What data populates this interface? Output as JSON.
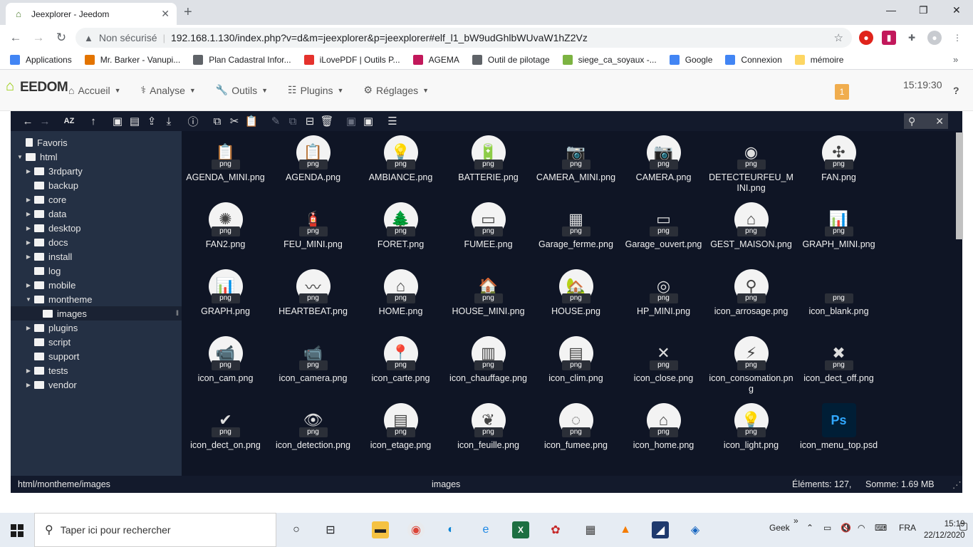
{
  "browser": {
    "tab_title": "Jeexplorer - Jeedom",
    "security_label": "Non sécurisé",
    "url": "192.168.1.130/index.php?v=d&m=jeexplorer&p=jeexplorer#elf_l1_bW9udGhlbWUvaW1hZ2Vz",
    "bookmarks": [
      {
        "label": "Applications",
        "color": "#4285f4"
      },
      {
        "label": "Mr. Barker - Vanupi...",
        "color": "#e37400"
      },
      {
        "label": "Plan Cadastral Infor...",
        "color": "#5f6368"
      },
      {
        "label": "iLovePDF | Outils P...",
        "color": "#e5322d"
      },
      {
        "label": "AGEMA",
        "color": "#c2185b"
      },
      {
        "label": "Outil de pilotage",
        "color": "#5f6368"
      },
      {
        "label": "siege_ca_soyaux -...",
        "color": "#7cb342"
      },
      {
        "label": "Google",
        "color": "#4285f4"
      },
      {
        "label": "Connexion",
        "color": "#4285f4"
      },
      {
        "label": "mémoire",
        "color": "#fdd663"
      }
    ]
  },
  "jeedom": {
    "logo_text": "EEDOM",
    "menu": [
      {
        "label": "Accueil",
        "icon": "home-icon"
      },
      {
        "label": "Analyse",
        "icon": "stethoscope-icon"
      },
      {
        "label": "Outils",
        "icon": "wrench-icon"
      },
      {
        "label": "Plugins",
        "icon": "list-icon"
      },
      {
        "label": "Réglages",
        "icon": "gear-icon"
      }
    ],
    "message_count": "1",
    "time": "15:19:30",
    "help_label": "?"
  },
  "explorer": {
    "tree": [
      {
        "label": "Favoris",
        "depth": 0,
        "arrow": "",
        "type": "star"
      },
      {
        "label": "html",
        "depth": 0,
        "arrow": "▼",
        "type": "folder"
      },
      {
        "label": "3rdparty",
        "depth": 1,
        "arrow": "▶",
        "type": "folder"
      },
      {
        "label": "backup",
        "depth": 1,
        "arrow": "",
        "type": "folder"
      },
      {
        "label": "core",
        "depth": 1,
        "arrow": "▶",
        "type": "folder"
      },
      {
        "label": "data",
        "depth": 1,
        "arrow": "▶",
        "type": "folder"
      },
      {
        "label": "desktop",
        "depth": 1,
        "arrow": "▶",
        "type": "folder"
      },
      {
        "label": "docs",
        "depth": 1,
        "arrow": "▶",
        "type": "folder"
      },
      {
        "label": "install",
        "depth": 1,
        "arrow": "▶",
        "type": "folder"
      },
      {
        "label": "log",
        "depth": 1,
        "arrow": "",
        "type": "folder"
      },
      {
        "label": "mobile",
        "depth": 1,
        "arrow": "▶",
        "type": "folder"
      },
      {
        "label": "montheme",
        "depth": 1,
        "arrow": "▼",
        "type": "folder"
      },
      {
        "label": "images",
        "depth": 2,
        "arrow": "",
        "type": "open-folder",
        "selected": true
      },
      {
        "label": "plugins",
        "depth": 1,
        "arrow": "▶",
        "type": "folder"
      },
      {
        "label": "script",
        "depth": 1,
        "arrow": "",
        "type": "folder"
      },
      {
        "label": "support",
        "depth": 1,
        "arrow": "",
        "type": "folder"
      },
      {
        "label": "tests",
        "depth": 1,
        "arrow": "▶",
        "type": "folder"
      },
      {
        "label": "vendor",
        "depth": 1,
        "arrow": "▶",
        "type": "folder"
      }
    ],
    "file_tag": "png",
    "files": [
      {
        "name": "AGENDA_MINI.png",
        "glyph": "📋",
        "circle": false
      },
      {
        "name": "AGENDA.png",
        "glyph": "📋",
        "circle": true
      },
      {
        "name": "AMBIANCE.png",
        "glyph": "💡",
        "circle": true
      },
      {
        "name": "BATTERIE.png",
        "glyph": "🔋",
        "circle": true
      },
      {
        "name": "CAMERA_MINI.png",
        "glyph": "📷",
        "circle": false
      },
      {
        "name": "CAMERA.png",
        "glyph": "📷",
        "circle": true
      },
      {
        "name": "DETECTEURFEU_MINI.png",
        "glyph": "◉",
        "circle": false
      },
      {
        "name": "FAN.png",
        "glyph": "✣",
        "circle": true
      },
      {
        "name": "FAN2.png",
        "glyph": "✺",
        "circle": true
      },
      {
        "name": "FEU_MINI.png",
        "glyph": "🧯",
        "circle": false
      },
      {
        "name": "FORET.png",
        "glyph": "🌲",
        "circle": true
      },
      {
        "name": "FUMEE.png",
        "glyph": "▭",
        "circle": true
      },
      {
        "name": "Garage_ferme.png",
        "glyph": "▦",
        "circle": false
      },
      {
        "name": "Garage_ouvert.png",
        "glyph": "▭",
        "circle": false
      },
      {
        "name": "GEST_MAISON.png",
        "glyph": "⌂",
        "circle": true
      },
      {
        "name": "GRAPH_MINI.png",
        "glyph": "📊",
        "circle": false
      },
      {
        "name": "GRAPH.png",
        "glyph": "📊",
        "circle": true
      },
      {
        "name": "HEARTBEAT.png",
        "glyph": "〰",
        "circle": true
      },
      {
        "name": "HOME.png",
        "glyph": "⌂",
        "circle": true
      },
      {
        "name": "HOUSE_MINI.png",
        "glyph": "🏠",
        "circle": false
      },
      {
        "name": "HOUSE.png",
        "glyph": "🏡",
        "circle": true
      },
      {
        "name": "HP_MINI.png",
        "glyph": "◎",
        "circle": false
      },
      {
        "name": "icon_arrosage.png",
        "glyph": "⚲",
        "circle": true
      },
      {
        "name": "icon_blank.png",
        "glyph": "",
        "circle": false
      },
      {
        "name": "icon_cam.png",
        "glyph": "📹",
        "circle": true
      },
      {
        "name": "icon_camera.png",
        "glyph": "📹",
        "circle": false
      },
      {
        "name": "icon_carte.png",
        "glyph": "📍",
        "circle": true
      },
      {
        "name": "icon_chauffage.png",
        "glyph": "▥",
        "circle": true
      },
      {
        "name": "icon_clim.png",
        "glyph": "▤",
        "circle": true
      },
      {
        "name": "icon_close.png",
        "glyph": "✕",
        "circle": false
      },
      {
        "name": "icon_consomation.png",
        "glyph": "⚡",
        "circle": true
      },
      {
        "name": "icon_dect_off.png",
        "glyph": "✖",
        "circle": false
      },
      {
        "name": "icon_dect_on.png",
        "glyph": "✔",
        "circle": false
      },
      {
        "name": "icon_detection.png",
        "glyph": "👁",
        "circle": false
      },
      {
        "name": "icon_etage.png",
        "glyph": "▤",
        "circle": true
      },
      {
        "name": "icon_feuille.png",
        "glyph": "❦",
        "circle": true
      },
      {
        "name": "icon_fumee.png",
        "glyph": "◌",
        "circle": true
      },
      {
        "name": "icon_home.png",
        "glyph": "⌂",
        "circle": true
      },
      {
        "name": "icon_light.png",
        "glyph": "💡",
        "circle": true
      },
      {
        "name": "icon_menu_top.psd",
        "glyph": "Ps",
        "circle": false,
        "tag": ""
      }
    ],
    "status": {
      "path": "html/montheme/images",
      "current": "images",
      "items": "Éléments: 127,",
      "size": "Somme: 1.69 MB"
    }
  },
  "taskbar": {
    "search_placeholder": "Taper ici pour rechercher",
    "geek": "Geek",
    "lang": "FRA",
    "time": "15:19",
    "date": "22/12/2020"
  },
  "colors": {
    "explorer_bg": "#0f1525",
    "sidebar_bg": "#243044",
    "badge": "#f0ad4e",
    "jeedom_green": "#94ca02"
  }
}
